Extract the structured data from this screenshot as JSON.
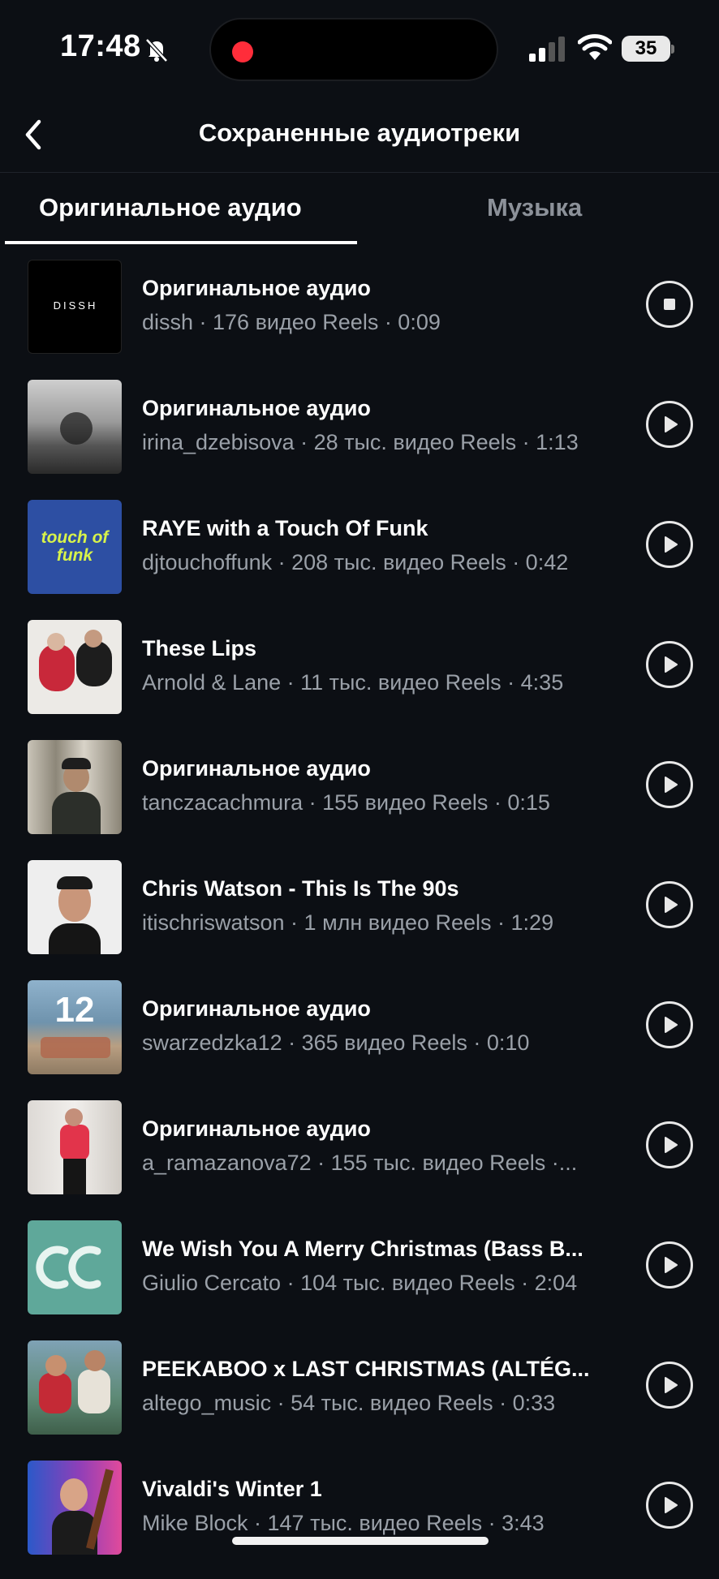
{
  "status_bar": {
    "time": "17:48",
    "battery": "35"
  },
  "header": {
    "title": "Сохраненные аудиотреки"
  },
  "tabs": [
    {
      "label": "Оригинальное аудио",
      "active": true
    },
    {
      "label": "Музыка",
      "active": false
    }
  ],
  "tracks": [
    {
      "title": "Оригинальное аудио",
      "subtitle": "dissh · 176 видео Reels · 0:09",
      "thumb_text": "DISSH",
      "state": "stop"
    },
    {
      "title": "Оригинальное аудио",
      "subtitle": "irina_dzebisova · 28 тыс. видео Reels · 1:13",
      "state": "play"
    },
    {
      "title": "RAYE with a Touch Of Funk",
      "subtitle": "djtouchoffunk · 208 тыс. видео Reels · 0:42",
      "thumb_text": "touch of funk",
      "state": "play"
    },
    {
      "title": "These Lips",
      "subtitle": "Arnold & Lane · 11 тыс. видео Reels · 4:35",
      "state": "play"
    },
    {
      "title": "Оригинальное аудио",
      "subtitle": "tanczacachmura · 155 видео Reels · 0:15",
      "state": "play"
    },
    {
      "title": "Chris Watson - This Is The 90s",
      "subtitle": "itischriswatson · 1 млн видео Reels · 1:29",
      "state": "play"
    },
    {
      "title": "Оригинальное аудио",
      "subtitle": "swarzedzka12 · 365 видео Reels · 0:10",
      "thumb_text": "12",
      "state": "play"
    },
    {
      "title": "Оригинальное аудио",
      "subtitle": "a_ramazanova72 · 155 тыс. видео Reels ·...",
      "state": "play"
    },
    {
      "title": "We Wish You A Merry Christmas (Bass B...",
      "subtitle": "Giulio Cercato · 104 тыс. видео Reels · 2:04",
      "state": "play"
    },
    {
      "title": "PEEKABOO x LAST CHRISTMAS (ALTÉG...",
      "subtitle": "altego_music · 54 тыс. видео Reels · 0:33",
      "state": "play"
    },
    {
      "title": "Vivaldi's Winter 1",
      "subtitle": "Mike Block · 147 тыс. видео Reels · 3:43",
      "state": "play"
    }
  ],
  "colors": {
    "background": "#0c0f14",
    "subtitle": "#9aa0a8",
    "record": "#ff2d3a"
  }
}
